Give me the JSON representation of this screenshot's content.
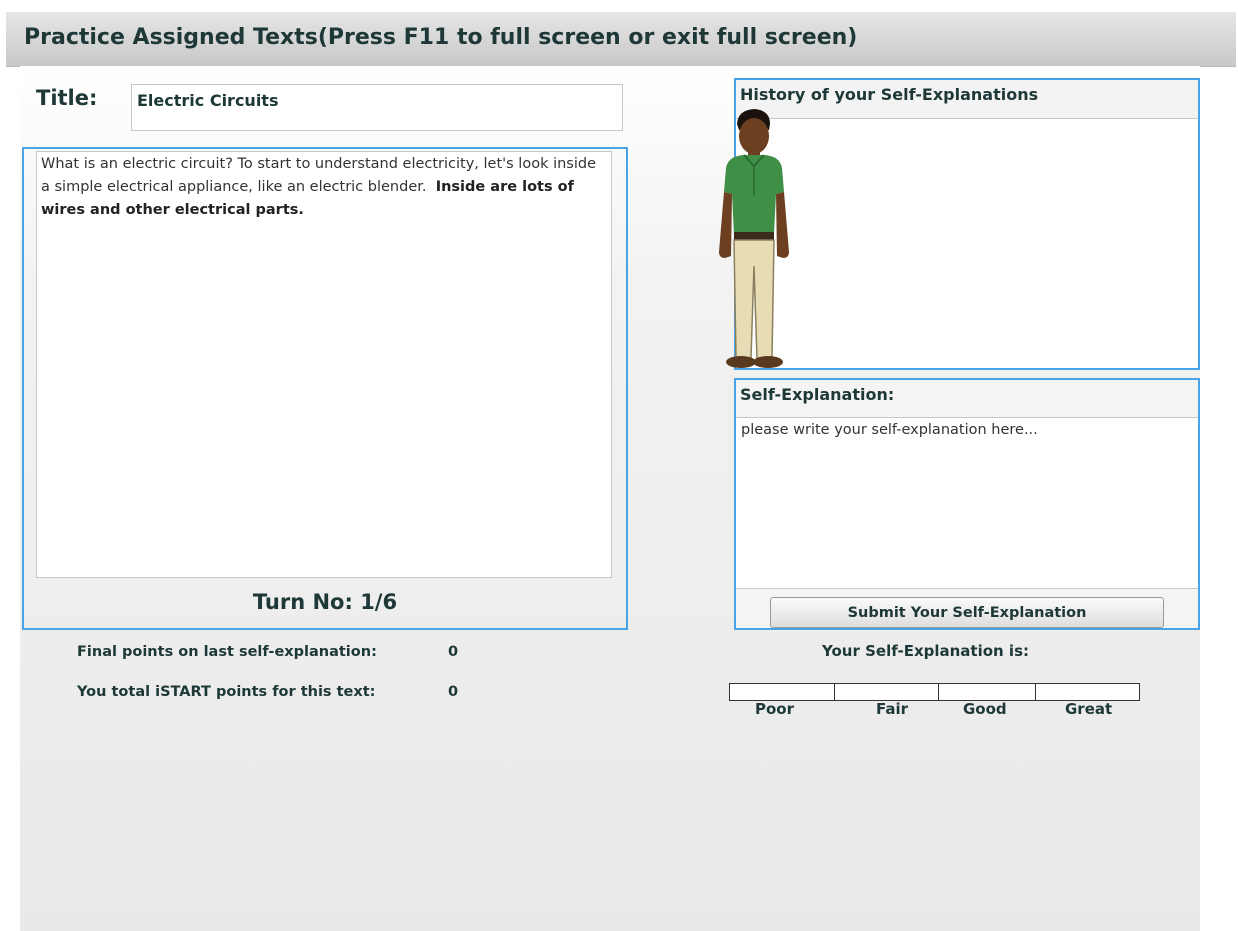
{
  "header": {
    "title": "Practice Assigned Texts(Press F11 to full screen or exit full screen)"
  },
  "text_section": {
    "title_label": "Title:",
    "title_value": "Electric Circuits",
    "passage_plain": "What is an electric circuit? To start to understand electricity, let's look inside a simple electrical appliance, like an electric blender.",
    "passage_bold": "Inside are lots of wires and other electrical parts.",
    "turn_label": "Turn No: 1/6"
  },
  "history": {
    "header": "History of your Self-Explanations"
  },
  "self_explanation": {
    "header": "Self-Explanation:",
    "placeholder": "please write your self-explanation here...",
    "submit_label": "Submit Your Self-Explanation"
  },
  "stats": {
    "final_points_label": "Final points on last self-explanation:",
    "final_points_value": "0",
    "total_points_label": "You total iSTART points for this text:",
    "total_points_value": "0"
  },
  "rating": {
    "title": "Your Self-Explanation is:",
    "levels": [
      "Poor",
      "Fair",
      "Good",
      "Great"
    ]
  },
  "colors": {
    "panel_border": "#4aa3e6",
    "text": "#1e3838",
    "shirt": "#3f8f46",
    "pants": "#e8dcb4"
  },
  "icons": {
    "agent": "animated-agent-character"
  }
}
